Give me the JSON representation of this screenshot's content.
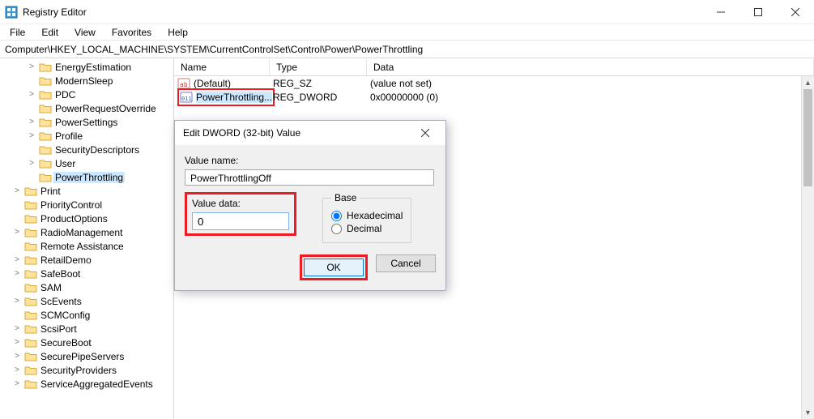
{
  "window": {
    "title": "Registry Editor"
  },
  "menu": {
    "file": "File",
    "edit": "Edit",
    "view": "View",
    "favorites": "Favorites",
    "help": "Help"
  },
  "address": "Computer\\HKEY_LOCAL_MACHINE\\SYSTEM\\CurrentControlSet\\Control\\Power\\PowerThrottling",
  "tree": {
    "items": [
      {
        "label": "EnergyEstimation",
        "expander": ">",
        "indent": 1
      },
      {
        "label": "ModernSleep",
        "expander": "",
        "indent": 1
      },
      {
        "label": "PDC",
        "expander": ">",
        "indent": 1
      },
      {
        "label": "PowerRequestOverride",
        "expander": "",
        "indent": 1
      },
      {
        "label": "PowerSettings",
        "expander": ">",
        "indent": 1
      },
      {
        "label": "Profile",
        "expander": ">",
        "indent": 1
      },
      {
        "label": "SecurityDescriptors",
        "expander": "",
        "indent": 1
      },
      {
        "label": "User",
        "expander": ">",
        "indent": 1
      },
      {
        "label": "PowerThrottling",
        "expander": "",
        "indent": 1,
        "selected": true
      },
      {
        "label": "Print",
        "expander": ">",
        "indent": 0
      },
      {
        "label": "PriorityControl",
        "expander": "",
        "indent": 0
      },
      {
        "label": "ProductOptions",
        "expander": "",
        "indent": 0
      },
      {
        "label": "RadioManagement",
        "expander": ">",
        "indent": 0
      },
      {
        "label": "Remote Assistance",
        "expander": "",
        "indent": 0
      },
      {
        "label": "RetailDemo",
        "expander": ">",
        "indent": 0
      },
      {
        "label": "SafeBoot",
        "expander": ">",
        "indent": 0
      },
      {
        "label": "SAM",
        "expander": "",
        "indent": 0
      },
      {
        "label": "ScEvents",
        "expander": ">",
        "indent": 0
      },
      {
        "label": "SCMConfig",
        "expander": "",
        "indent": 0
      },
      {
        "label": "ScsiPort",
        "expander": ">",
        "indent": 0
      },
      {
        "label": "SecureBoot",
        "expander": ">",
        "indent": 0
      },
      {
        "label": "SecurePipeServers",
        "expander": ">",
        "indent": 0
      },
      {
        "label": "SecurityProviders",
        "expander": ">",
        "indent": 0
      },
      {
        "label": "ServiceAggregatedEvents",
        "expander": ">",
        "indent": 0
      }
    ]
  },
  "list": {
    "columns": {
      "name": "Name",
      "type": "Type",
      "data": "Data"
    },
    "rows": [
      {
        "icon": "sz",
        "name": "(Default)",
        "type": "REG_SZ",
        "data": "(value not set)"
      },
      {
        "icon": "dw",
        "name": "PowerThrottling...",
        "type": "REG_DWORD",
        "data": "0x00000000 (0)",
        "selected": true
      }
    ]
  },
  "dialog": {
    "title": "Edit DWORD (32-bit) Value",
    "name_label": "Value name:",
    "name_value": "PowerThrottlingOff",
    "data_label": "Value data:",
    "data_value": "0",
    "base_label": "Base",
    "hex_label": "Hexadecimal",
    "dec_label": "Decimal",
    "ok": "OK",
    "cancel": "Cancel"
  }
}
